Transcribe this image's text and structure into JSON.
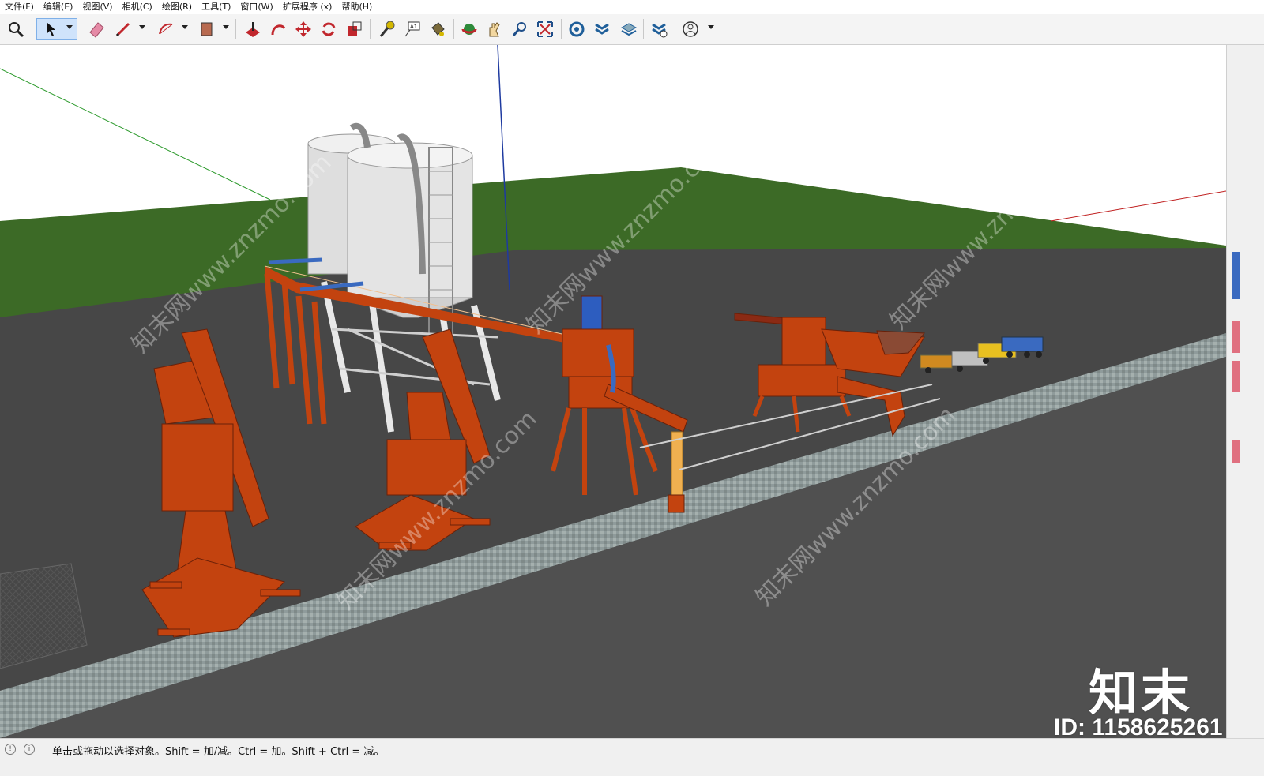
{
  "menu": [
    "文件(F)",
    "编辑(E)",
    "视图(V)",
    "相机(C)",
    "绘图(R)",
    "工具(T)",
    "窗口(W)",
    "扩展程序 (x)",
    "帮助(H)"
  ],
  "status": {
    "text": "单击或拖动以选择对象。Shift = 加/减。Ctrl = 加。Shift + Ctrl = 减。"
  },
  "watermark": {
    "brand": "知末",
    "id": "ID: 1158625261",
    "text": "知末网www.znzmo.com"
  },
  "colors": {
    "ground": "#474747",
    "grass": "#3c6a26",
    "crane": "#c3430f",
    "silo": "#e4e4e4",
    "quay": "#8e9a9a"
  }
}
